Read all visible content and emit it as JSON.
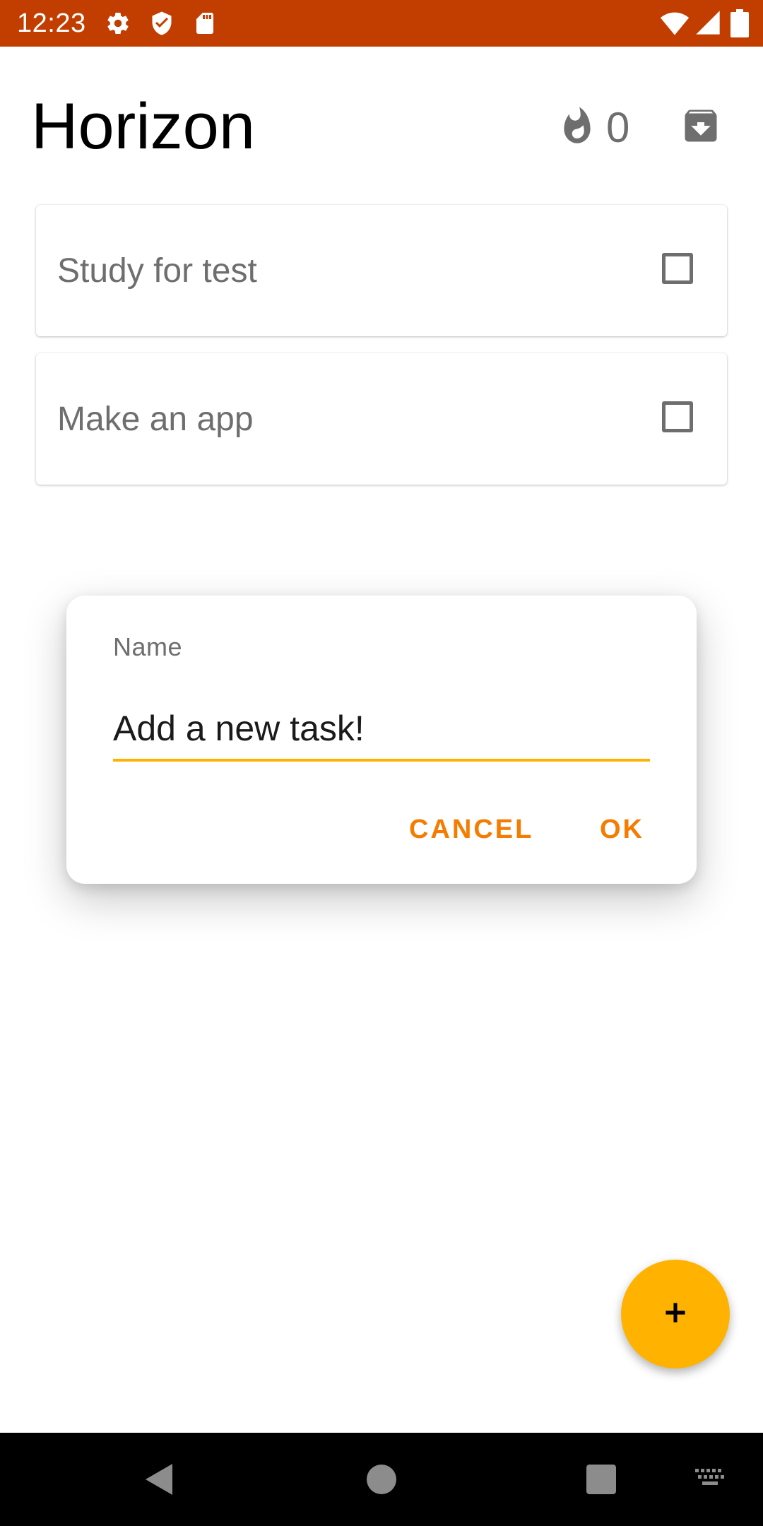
{
  "status_bar": {
    "time": "12:23",
    "background_color": "#c23e00",
    "left_icons": [
      "settings-icon",
      "shield-icon",
      "sd-card-icon"
    ],
    "right_icons": [
      "wifi-icon",
      "cell-signal-icon",
      "battery-icon"
    ]
  },
  "header": {
    "title": "Horizon",
    "streak_icon": "flame-icon",
    "streak_count": "0",
    "archive_icon": "archive-icon"
  },
  "tasks": [
    {
      "label": "Study for test",
      "checked": false
    },
    {
      "label": "Make an app",
      "checked": false
    }
  ],
  "dialog": {
    "field_label": "Name",
    "input_value": "Add a new task!",
    "cancel_label": "CANCEL",
    "ok_label": "OK",
    "accent_color": "#ffb300",
    "button_color": "#f57c00"
  },
  "fab": {
    "icon": "plus-icon",
    "color": "#ffb300"
  },
  "nav_bar": {
    "icons": [
      "back-icon",
      "home-icon",
      "recents-icon",
      "keyboard-icon"
    ]
  }
}
